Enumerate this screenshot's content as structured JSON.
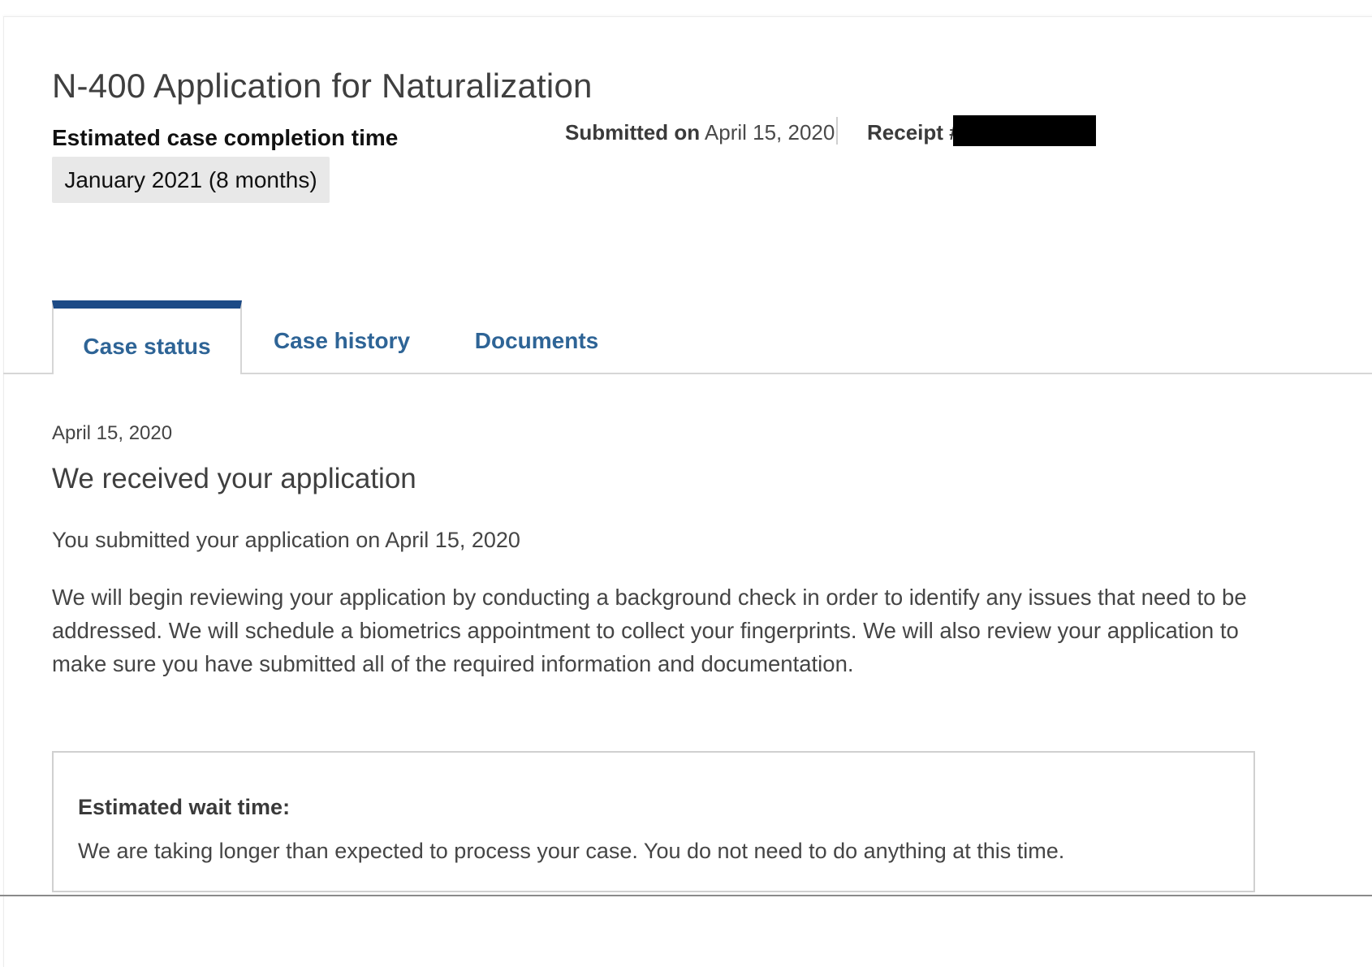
{
  "header": {
    "title": "N-400 Application for Naturalization",
    "estimate_label": "Estimated case completion time",
    "estimate_value": "January 2021 (8 months)",
    "submitted_label": "Submitted on",
    "submitted_date": "April 15, 2020",
    "receipt_label": "Receipt #"
  },
  "tabs": [
    {
      "label": "Case status",
      "active": true
    },
    {
      "label": "Case history",
      "active": false
    },
    {
      "label": "Documents",
      "active": false
    }
  ],
  "status": {
    "date": "April 15, 2020",
    "heading": "We received your application",
    "submitted_line": "You submitted your application on April 15, 2020",
    "body": "We will begin reviewing your application by conducting a background check in order to identify any issues that need to be addressed. We will schedule a biometrics appointment to collect your fingerprints. We will also review your application to make sure you have submitted all of the required information and documentation."
  },
  "wait": {
    "label": "Estimated wait time:",
    "text": "We are taking longer than expected to process your case. You do not need to do anything at this time."
  },
  "colors": {
    "tab_text": "#2e6496",
    "active_tab_bar": "#1c4a86",
    "estimate_bg": "#e8e8e8"
  }
}
